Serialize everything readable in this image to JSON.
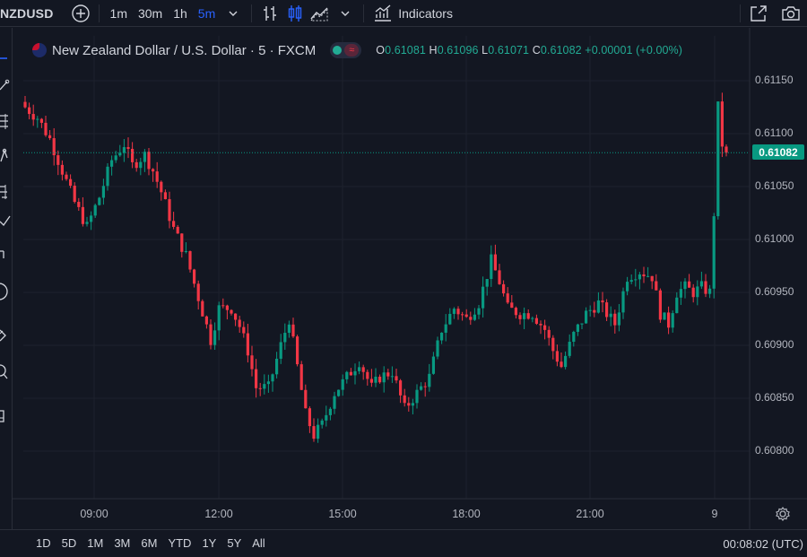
{
  "header": {
    "symbol": "NZDUSD",
    "intervals": [
      "1m",
      "30m",
      "1h",
      "5m"
    ],
    "active_interval": "5m",
    "indicators_label": "Indicators"
  },
  "legend": {
    "title": "New Zealand Dollar / U.S. Dollar · 5 · FXCM",
    "open_label": "O",
    "open": "0.61081",
    "high_label": "H",
    "high": "0.61096",
    "low_label": "L",
    "low": "0.61071",
    "close_label": "C",
    "close": "0.61082",
    "change": "+0.00001 (+0.00%)"
  },
  "price_axis": {
    "labels": [
      "0.61150",
      "0.61100",
      "0.61050",
      "0.61000",
      "0.60950",
      "0.60900",
      "0.60850",
      "0.60800"
    ],
    "current_price": "0.61082"
  },
  "time_axis": {
    "labels": [
      "09:00",
      "12:00",
      "15:00",
      "18:00",
      "21:00",
      "9"
    ]
  },
  "footer": {
    "ranges": [
      "1D",
      "5D",
      "1M",
      "3M",
      "6M",
      "YTD",
      "1Y",
      "5Y",
      "All"
    ],
    "clock": "00:08:02 (UTC)"
  },
  "colors": {
    "background": "#131722",
    "up": "#089981",
    "down": "#f23645",
    "accent": "#2962ff",
    "grid": "#1e222d"
  },
  "icons": {
    "add": "plus-circle-icon",
    "bars": "bar-chart-icon",
    "candles": "candlestick-icon",
    "area": "area-chart-icon",
    "indicators": "indicators-icon",
    "fullscreen": "fullscreen-icon",
    "snapshot": "camera-icon",
    "settings": "gear-icon"
  },
  "chart_data": {
    "type": "candlestick",
    "title": "New Zealand Dollar / U.S. Dollar · 5 · FXCM",
    "x_ticks": [
      "09:00",
      "12:00",
      "15:00",
      "18:00",
      "21:00",
      "9"
    ],
    "y_ticks": [
      0.6115,
      0.611,
      0.6105,
      0.61,
      0.6095,
      0.609,
      0.6085,
      0.608
    ],
    "ylim": [
      0.6076,
      0.6117
    ],
    "grid": true,
    "last_price": 0.61082,
    "close_path": [
      [
        0,
        0.61125
      ],
      [
        3,
        0.61115
      ],
      [
        6,
        0.61095
      ],
      [
        9,
        0.61065
      ],
      [
        12,
        0.61035
      ],
      [
        15,
        0.61012
      ],
      [
        18,
        0.6104
      ],
      [
        21,
        0.61075
      ],
      [
        24,
        0.6109
      ],
      [
        26,
        0.6107
      ],
      [
        29,
        0.6108
      ],
      [
        31,
        0.61065
      ],
      [
        33,
        0.61045
      ],
      [
        36,
        0.6101
      ],
      [
        39,
        0.60985
      ],
      [
        42,
        0.60945
      ],
      [
        45,
        0.60905
      ],
      [
        47,
        0.60935
      ],
      [
        50,
        0.60935
      ],
      [
        52,
        0.60918
      ],
      [
        54,
        0.60895
      ],
      [
        56,
        0.6086
      ],
      [
        59,
        0.6086
      ],
      [
        62,
        0.609
      ],
      [
        64,
        0.60925
      ],
      [
        66,
        0.6088
      ],
      [
        68,
        0.60835
      ],
      [
        70,
        0.60815
      ],
      [
        72,
        0.60825
      ],
      [
        75,
        0.60855
      ],
      [
        78,
        0.6087
      ],
      [
        81,
        0.60885
      ],
      [
        84,
        0.6086
      ],
      [
        86,
        0.6087
      ],
      [
        89,
        0.60875
      ],
      [
        92,
        0.6084
      ],
      [
        95,
        0.60855
      ],
      [
        98,
        0.6087
      ],
      [
        101,
        0.60915
      ],
      [
        104,
        0.60935
      ],
      [
        107,
        0.60925
      ],
      [
        110,
        0.6094
      ],
      [
        113,
        0.6098
      ],
      [
        115,
        0.6096
      ],
      [
        117,
        0.60935
      ],
      [
        120,
        0.6093
      ],
      [
        123,
        0.6093
      ],
      [
        126,
        0.60915
      ],
      [
        128,
        0.60895
      ],
      [
        130,
        0.6088
      ],
      [
        133,
        0.6091
      ],
      [
        136,
        0.6093
      ],
      [
        139,
        0.6094
      ],
      [
        141,
        0.6093
      ],
      [
        143,
        0.6092
      ],
      [
        146,
        0.60965
      ],
      [
        149,
        0.6097
      ],
      [
        152,
        0.60965
      ],
      [
        154,
        0.6093
      ],
      [
        156,
        0.6092
      ],
      [
        158,
        0.6095
      ],
      [
        160,
        0.60955
      ],
      [
        162,
        0.6095
      ],
      [
        164,
        0.60955
      ],
      [
        166,
        0.6095
      ],
      [
        167,
        0.61025
      ],
      [
        168,
        0.61125
      ],
      [
        169,
        0.6109
      ],
      [
        170,
        0.61082
      ]
    ]
  }
}
